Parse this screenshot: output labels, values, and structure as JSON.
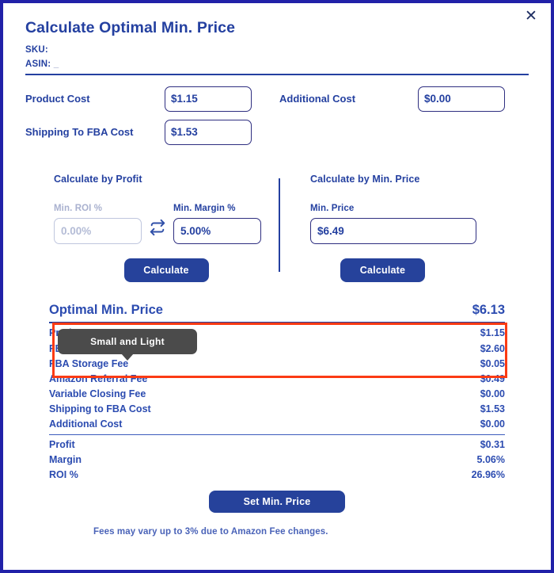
{
  "window": {
    "border_color": "#2121a8",
    "close_icon": "close-icon"
  },
  "header": {
    "title": "Calculate Optimal Min. Price",
    "sku_label": "SKU:",
    "sku_value": "",
    "asin_label": "ASIN:",
    "asin_value": "_"
  },
  "costs": {
    "product_cost_label": "Product Cost",
    "product_cost_value": "$1.15",
    "additional_cost_label": "Additional Cost",
    "additional_cost_value": "$0.00",
    "shipping_fba_label": "Shipping To FBA Cost",
    "shipping_fba_value": "$1.53"
  },
  "calc_profit": {
    "heading": "Calculate by Profit",
    "min_roi_label": "Min. ROI %",
    "min_roi_value": "0.00%",
    "min_roi_disabled": true,
    "swap_icon": "swap-icon",
    "min_margin_label": "Min. Margin %",
    "min_margin_value": "5.00%",
    "button_label": "Calculate"
  },
  "calc_price": {
    "heading": "Calculate by Min. Price",
    "min_price_label": "Min. Price",
    "min_price_value": "$6.49",
    "button_label": "Calculate"
  },
  "results": {
    "optimal_label": "Optimal Min. Price",
    "optimal_value": "$6.13",
    "product_cost_label": "Product Cost",
    "product_cost_value": "$1.15",
    "fba_fee_label": "FBA Fee",
    "fba_fee_icon": "info-icon",
    "fba_fee_value": "$2.60",
    "rows": [
      {
        "label": "FBA Storage Fee",
        "value": "$0.05"
      },
      {
        "label": "Amazon Referral Fee",
        "value": "$0.49"
      },
      {
        "label": "Variable Closing Fee",
        "value": "$0.00"
      },
      {
        "label": "Shipping to FBA Cost",
        "value": "$1.53"
      },
      {
        "label": "Additional Cost",
        "value": "$0.00"
      }
    ],
    "summary": [
      {
        "label": "Profit",
        "value": "$0.31"
      },
      {
        "label": "Margin",
        "value": "5.06%"
      },
      {
        "label": "ROI %",
        "value": "26.96%"
      }
    ]
  },
  "tooltip": {
    "text": "Small and Light",
    "background": "#4b4b4b"
  },
  "highlight": {
    "color": "#fb3b14"
  },
  "footer": {
    "set_min_price_label": "Set Min. Price",
    "note": "Fees may vary up to 3% due to Amazon Fee changes."
  }
}
